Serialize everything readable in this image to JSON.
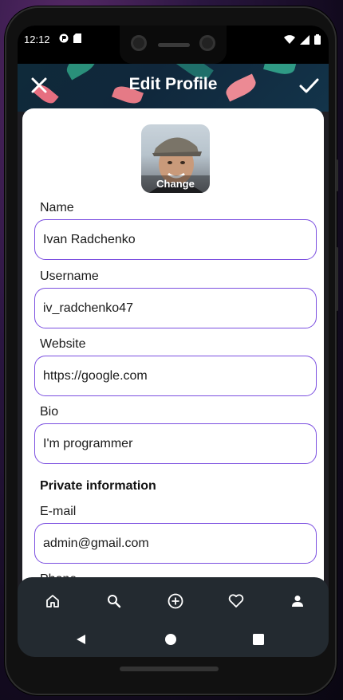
{
  "status_bar": {
    "time": "12:12"
  },
  "header": {
    "title": "Edit Profile"
  },
  "avatar": {
    "action_label": "Change"
  },
  "form": {
    "name": {
      "label": "Name",
      "value": "Ivan Radchenko"
    },
    "username": {
      "label": "Username",
      "value": "iv_radchenko47"
    },
    "website": {
      "label": "Website",
      "value": "https://google.com"
    },
    "bio": {
      "label": "Bio",
      "value": "I'm programmer"
    },
    "private_section_title": "Private information",
    "email": {
      "label": "E-mail",
      "value": "admin@gmail.com"
    },
    "phone": {
      "label": "Phone"
    }
  },
  "bottom_nav": {
    "items": [
      "home-icon",
      "search-icon",
      "add-circle-icon",
      "heart-icon",
      "person-icon"
    ]
  },
  "system_nav": {
    "items": [
      "back",
      "home",
      "recents"
    ]
  },
  "colors": {
    "accent": "#7b4fe0",
    "nav_bg": "#232a30",
    "header_bg": "#13344a"
  }
}
